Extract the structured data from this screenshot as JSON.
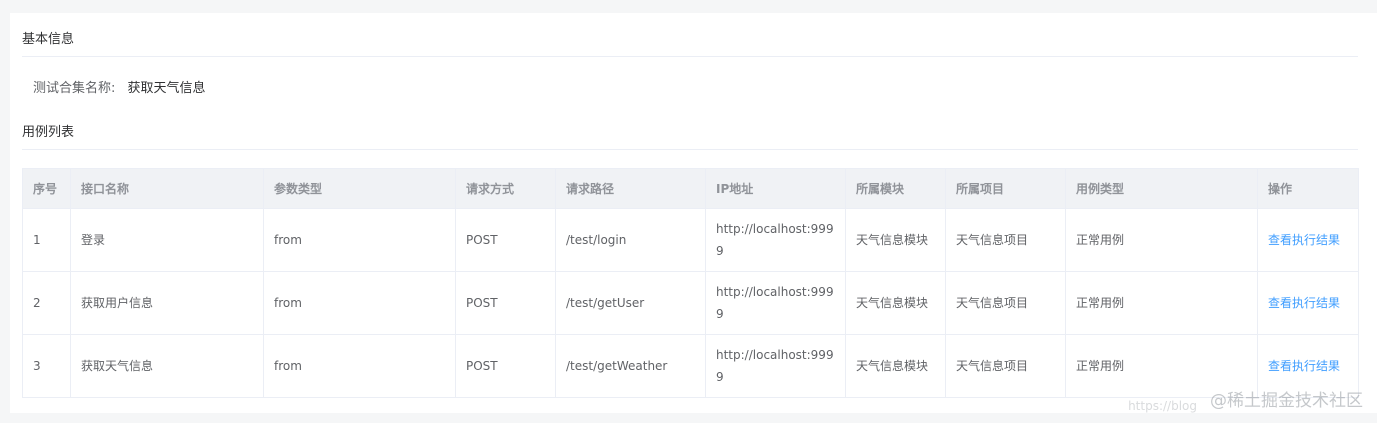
{
  "basic_info": {
    "title": "基本信息",
    "collection_label": "测试合集名称:",
    "collection_value": "获取天气信息"
  },
  "case_list": {
    "title": "用例列表",
    "columns": [
      "序号",
      "接口名称",
      "参数类型",
      "请求方式",
      "请求路径",
      "IP地址",
      "所属模块",
      "所属项目",
      "用例类型",
      "操作"
    ],
    "rows": [
      {
        "index": "1",
        "name": "登录",
        "param_type": "from",
        "method": "POST",
        "path": "/test/login",
        "ip": "http://localhost:9999",
        "module": "天气信息模块",
        "project": "天气信息项目",
        "case_type": "正常用例",
        "action": "查看执行结果"
      },
      {
        "index": "2",
        "name": "获取用户信息",
        "param_type": "from",
        "method": "POST",
        "path": "/test/getUser",
        "ip": "http://localhost:9999",
        "module": "天气信息模块",
        "project": "天气信息项目",
        "case_type": "正常用例",
        "action": "查看执行结果"
      },
      {
        "index": "3",
        "name": "获取天气信息",
        "param_type": "from",
        "method": "POST",
        "path": "/test/getWeather",
        "ip": "http://localhost:9999",
        "module": "天气信息模块",
        "project": "天气信息项目",
        "case_type": "正常用例",
        "action": "查看执行结果"
      }
    ]
  },
  "watermark": {
    "text": "@稀土掘金技术社区",
    "url": "https://blog"
  },
  "colors": {
    "link": "#409eff",
    "header_bg": "#f0f2f5",
    "border": "#ebeef5"
  }
}
